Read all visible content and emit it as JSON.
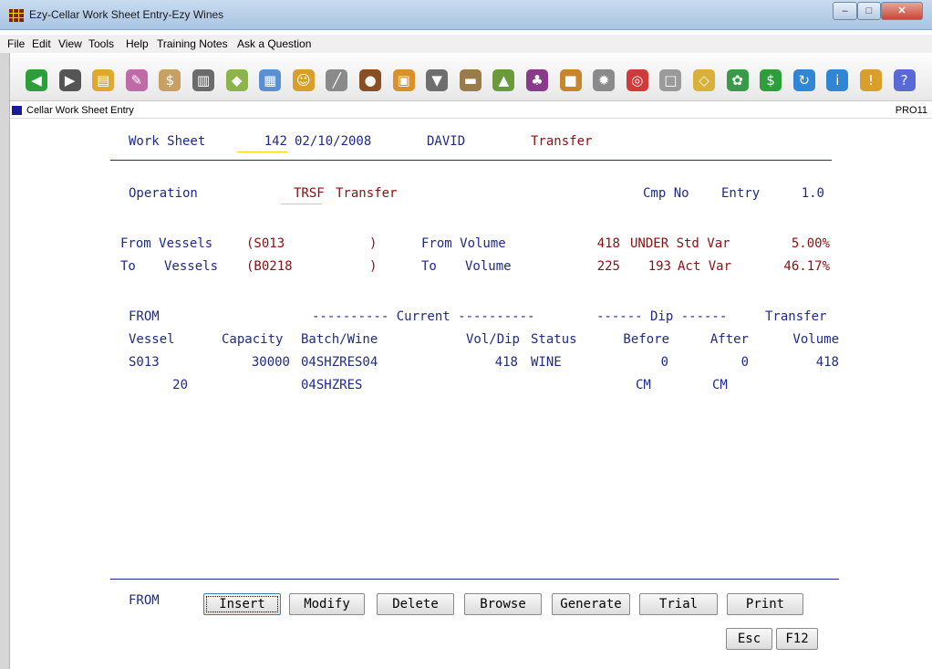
{
  "window": {
    "title": "Ezy-Cellar Work Sheet Entry-Ezy Wines",
    "min": "–",
    "max": "□",
    "close": "✕"
  },
  "menu": [
    "File",
    "Edit",
    "View",
    "Tools",
    "Help",
    "Training Notes",
    "Ask a Question"
  ],
  "toolbar": {
    "icons": [
      {
        "name": "back-arrow-icon",
        "glyph": "◀",
        "color": "#2e9e3a"
      },
      {
        "name": "forward-arrow-icon",
        "glyph": "▶",
        "color": "#555555"
      },
      {
        "name": "folder-icon",
        "glyph": "▤",
        "color": "#e0a82e"
      },
      {
        "name": "pencil-icon",
        "glyph": "✎",
        "color": "#c06aa8"
      },
      {
        "name": "hand-money-icon",
        "glyph": "$",
        "color": "#c9a064"
      },
      {
        "name": "building-icon",
        "glyph": "▥",
        "color": "#6b6b6b"
      },
      {
        "name": "tag-icon",
        "glyph": "◆",
        "color": "#8db44a"
      },
      {
        "name": "document-icon",
        "glyph": "▦",
        "color": "#5b8fd4"
      },
      {
        "name": "people-icon",
        "glyph": "☺",
        "color": "#d99f2a"
      },
      {
        "name": "syringe-icon",
        "glyph": "╱",
        "color": "#8a8a8a"
      },
      {
        "name": "barrel-icon",
        "glyph": "●",
        "color": "#8a4e22"
      },
      {
        "name": "box-open-icon",
        "glyph": "▣",
        "color": "#d9922a"
      },
      {
        "name": "bottle-filler-icon",
        "glyph": "▼",
        "color": "#6e6e6e"
      },
      {
        "name": "truck-icon",
        "glyph": "▬",
        "color": "#9a7b4a"
      },
      {
        "name": "bottles-icon",
        "glyph": "▲",
        "color": "#6a9a3a"
      },
      {
        "name": "grapes-icon",
        "glyph": "♣",
        "color": "#8a3a8a"
      },
      {
        "name": "briefcase-icon",
        "glyph": "■",
        "color": "#c9852a"
      },
      {
        "name": "gear-icon",
        "glyph": "✹",
        "color": "#8a8a8a"
      },
      {
        "name": "globe-icon",
        "glyph": "◎",
        "color": "#d03a3a"
      },
      {
        "name": "window-icon",
        "glyph": "□",
        "color": "#9a9a9a"
      },
      {
        "name": "cube-icon",
        "glyph": "◇",
        "color": "#d9b03a"
      },
      {
        "name": "leaf-icon",
        "glyph": "✿",
        "color": "#3a9a4a"
      },
      {
        "name": "dollar-icon",
        "glyph": "$",
        "color": "#2e9e3a"
      },
      {
        "name": "refresh-icon",
        "glyph": "↻",
        "color": "#2e86d4"
      },
      {
        "name": "info-icon",
        "glyph": "i",
        "color": "#2e86d4"
      },
      {
        "name": "alert-icon",
        "glyph": "!",
        "color": "#d99f2a"
      },
      {
        "name": "help-icon",
        "glyph": "?",
        "color": "#5a6ad4"
      }
    ]
  },
  "subheader": {
    "title": "Cellar Work Sheet Entry",
    "code": "PRO11"
  },
  "worksheet": {
    "label": "Work Sheet",
    "number": "142",
    "date": "02/10/2008",
    "user": "DAVID",
    "type": "Transfer"
  },
  "operation": {
    "label": "Operation",
    "code": "TRSF",
    "desc": "Transfer",
    "cmp_label": "Cmp No",
    "entry_label": "Entry",
    "entry_value": "1.0"
  },
  "from": {
    "label": "From Vessels",
    "vessels": "(S013",
    "close_paren": ")",
    "vol_label": "From Volume",
    "volume": "418",
    "var_label": "UNDER Std Var",
    "var_value": "5.00%"
  },
  "to": {
    "label_a": "To",
    "label_b": "Vessels",
    "vessels": "(B0218",
    "close_paren": ")",
    "vol_label_a": "To",
    "vol_label_b": "Volume",
    "volume": "225",
    "diff": "193",
    "var_label": "Act Var",
    "var_value": "46.17%"
  },
  "table": {
    "group_header_from": "FROM",
    "group_header_current": "---------- Current ----------",
    "group_header_dip": "------ Dip ------",
    "group_header_transfer": "Transfer",
    "columns": [
      "Vessel",
      "Capacity",
      "Batch/Wine",
      "Vol/Dip",
      "Status",
      "Before",
      "After",
      "Volume"
    ],
    "row": {
      "vessel": "S013",
      "capacity": "30000",
      "batch": "04SHZRES04",
      "vol": "418",
      "status": "WINE",
      "before": "0",
      "after": "0",
      "transfer": "418"
    },
    "subrow": {
      "capacity": "20",
      "batch": "04SHZRES",
      "before_unit": "CM",
      "after_unit": "CM"
    }
  },
  "footer": {
    "mode": "FROM",
    "buttons": [
      "Insert",
      "Modify",
      "Delete",
      "Browse",
      "Generate",
      "Trial",
      "Print"
    ],
    "esc": "Esc",
    "f12": "F12"
  }
}
